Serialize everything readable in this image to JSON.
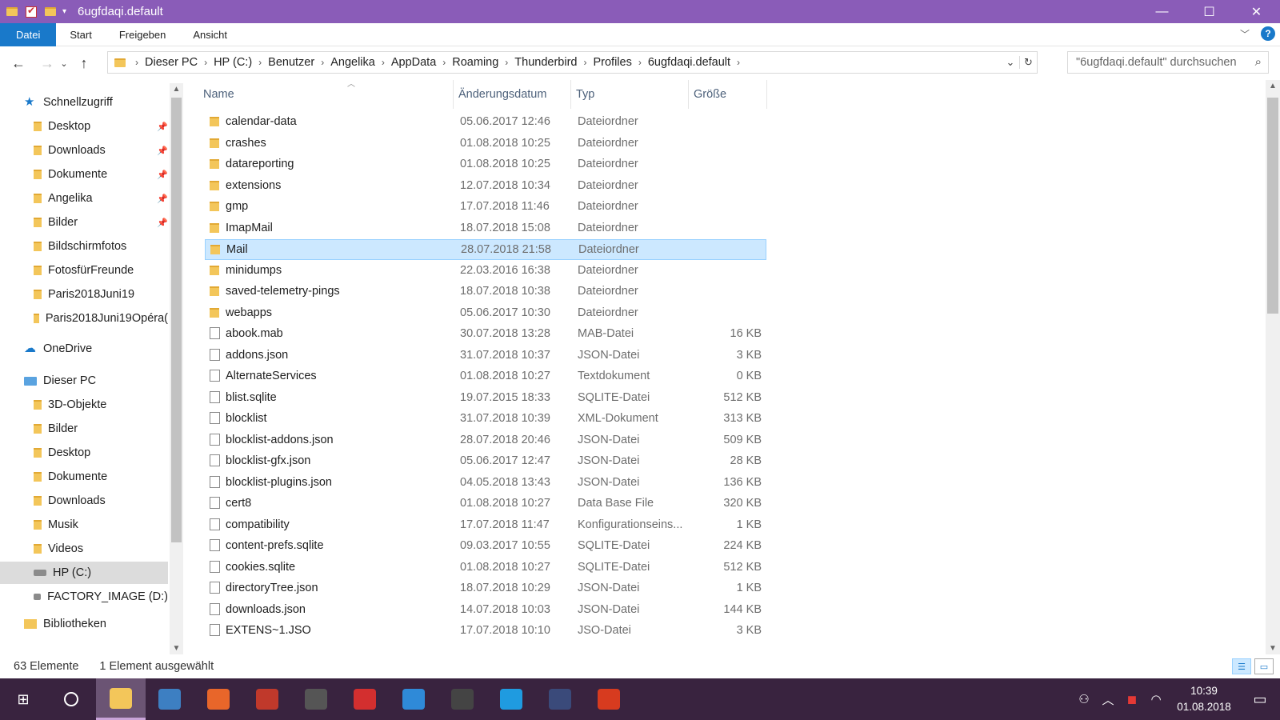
{
  "window": {
    "title": "6ugfdaqi.default",
    "controls": {
      "minimize": "—",
      "maximize": "☐",
      "close": "✕"
    }
  },
  "ribbon": {
    "tabs": [
      "Datei",
      "Start",
      "Freigeben",
      "Ansicht"
    ],
    "expand_icon": "chevron-down",
    "help": "?"
  },
  "address": {
    "crumbs": [
      "Dieser PC",
      "HP (C:)",
      "Benutzer",
      "Angelika",
      "AppData",
      "Roaming",
      "Thunderbird",
      "Profiles",
      "6ugfdaqi.default"
    ],
    "search_placeholder": "\"6ugfdaqi.default\" durchsuchen"
  },
  "nav": {
    "items": [
      {
        "label": "Schnellzugriff",
        "icon": "star",
        "pinned": false
      },
      {
        "label": "Desktop",
        "icon": "folder",
        "pinned": true
      },
      {
        "label": "Downloads",
        "icon": "folder",
        "pinned": true
      },
      {
        "label": "Dokumente",
        "icon": "folder",
        "pinned": true
      },
      {
        "label": "Angelika",
        "icon": "folder",
        "pinned": true
      },
      {
        "label": "Bilder",
        "icon": "folder",
        "pinned": true
      },
      {
        "label": "Bildschirmfotos",
        "icon": "folder",
        "pinned": false
      },
      {
        "label": "FotosfürFreunde",
        "icon": "folder",
        "pinned": false
      },
      {
        "label": "Paris2018Juni19",
        "icon": "folder",
        "pinned": false
      },
      {
        "label": "Paris2018Juni19Opéra(",
        "icon": "folder",
        "pinned": false
      },
      {
        "label": "OneDrive",
        "icon": "cloud",
        "pinned": false
      },
      {
        "label": "Dieser PC",
        "icon": "pc",
        "pinned": false
      },
      {
        "label": "3D-Objekte",
        "icon": "folder",
        "pinned": false
      },
      {
        "label": "Bilder",
        "icon": "folder",
        "pinned": false
      },
      {
        "label": "Desktop",
        "icon": "folder",
        "pinned": false
      },
      {
        "label": "Dokumente",
        "icon": "folder",
        "pinned": false
      },
      {
        "label": "Downloads",
        "icon": "folder",
        "pinned": false
      },
      {
        "label": "Musik",
        "icon": "folder",
        "pinned": false
      },
      {
        "label": "Videos",
        "icon": "folder",
        "pinned": false
      },
      {
        "label": "HP (C:)",
        "icon": "drive",
        "pinned": false,
        "selected": true
      },
      {
        "label": "FACTORY_IMAGE (D:)",
        "icon": "drive",
        "pinned": false
      },
      {
        "label": "Bibliotheken",
        "icon": "lib",
        "pinned": false
      }
    ]
  },
  "columns": {
    "name": "Name",
    "date": "Änderungsdatum",
    "type": "Typ",
    "size": "Größe"
  },
  "files": [
    {
      "name": "calendar-data",
      "date": "05.06.2017 12:46",
      "type": "Dateiordner",
      "size": "",
      "kind": "folder"
    },
    {
      "name": "crashes",
      "date": "01.08.2018 10:25",
      "type": "Dateiordner",
      "size": "",
      "kind": "folder"
    },
    {
      "name": "datareporting",
      "date": "01.08.2018 10:25",
      "type": "Dateiordner",
      "size": "",
      "kind": "folder"
    },
    {
      "name": "extensions",
      "date": "12.07.2018 10:34",
      "type": "Dateiordner",
      "size": "",
      "kind": "folder"
    },
    {
      "name": "gmp",
      "date": "17.07.2018 11:46",
      "type": "Dateiordner",
      "size": "",
      "kind": "folder"
    },
    {
      "name": "ImapMail",
      "date": "18.07.2018 15:08",
      "type": "Dateiordner",
      "size": "",
      "kind": "folder"
    },
    {
      "name": "Mail",
      "date": "28.07.2018 21:58",
      "type": "Dateiordner",
      "size": "",
      "kind": "folder",
      "selected": true
    },
    {
      "name": "minidumps",
      "date": "22.03.2016 16:38",
      "type": "Dateiordner",
      "size": "",
      "kind": "folder"
    },
    {
      "name": "saved-telemetry-pings",
      "date": "18.07.2018 10:38",
      "type": "Dateiordner",
      "size": "",
      "kind": "folder"
    },
    {
      "name": "webapps",
      "date": "05.06.2017 10:30",
      "type": "Dateiordner",
      "size": "",
      "kind": "folder"
    },
    {
      "name": "abook.mab",
      "date": "30.07.2018 13:28",
      "type": "MAB-Datei",
      "size": "16 KB",
      "kind": "file"
    },
    {
      "name": "addons.json",
      "date": "31.07.2018 10:37",
      "type": "JSON-Datei",
      "size": "3 KB",
      "kind": "file"
    },
    {
      "name": "AlternateServices",
      "date": "01.08.2018 10:27",
      "type": "Textdokument",
      "size": "0 KB",
      "kind": "file"
    },
    {
      "name": "blist.sqlite",
      "date": "19.07.2015 18:33",
      "type": "SQLITE-Datei",
      "size": "512 KB",
      "kind": "file"
    },
    {
      "name": "blocklist",
      "date": "31.07.2018 10:39",
      "type": "XML-Dokument",
      "size": "313 KB",
      "kind": "file"
    },
    {
      "name": "blocklist-addons.json",
      "date": "28.07.2018 20:46",
      "type": "JSON-Datei",
      "size": "509 KB",
      "kind": "file"
    },
    {
      "name": "blocklist-gfx.json",
      "date": "05.06.2017 12:47",
      "type": "JSON-Datei",
      "size": "28 KB",
      "kind": "file"
    },
    {
      "name": "blocklist-plugins.json",
      "date": "04.05.2018 13:43",
      "type": "JSON-Datei",
      "size": "136 KB",
      "kind": "file"
    },
    {
      "name": "cert8",
      "date": "01.08.2018 10:27",
      "type": "Data Base File",
      "size": "320 KB",
      "kind": "file"
    },
    {
      "name": "compatibility",
      "date": "17.07.2018 11:47",
      "type": "Konfigurationseins...",
      "size": "1 KB",
      "kind": "file"
    },
    {
      "name": "content-prefs.sqlite",
      "date": "09.03.2017 10:55",
      "type": "SQLITE-Datei",
      "size": "224 KB",
      "kind": "file"
    },
    {
      "name": "cookies.sqlite",
      "date": "01.08.2018 10:27",
      "type": "SQLITE-Datei",
      "size": "512 KB",
      "kind": "file"
    },
    {
      "name": "directoryTree.json",
      "date": "18.07.2018 10:29",
      "type": "JSON-Datei",
      "size": "1 KB",
      "kind": "file"
    },
    {
      "name": "downloads.json",
      "date": "14.07.2018 10:03",
      "type": "JSON-Datei",
      "size": "144 KB",
      "kind": "file"
    },
    {
      "name": "EXTENS~1.JSO",
      "date": "17.07.2018 10:10",
      "type": "JSO-Datei",
      "size": "3 KB",
      "kind": "file"
    }
  ],
  "status": {
    "count": "63 Elemente",
    "selection": "1 Element ausgewählt"
  },
  "taskbar": {
    "apps": [
      {
        "name": "explorer",
        "color": "#f3c65a",
        "active": true
      },
      {
        "name": "thunderbird",
        "color": "#3d7fc2"
      },
      {
        "name": "firefox",
        "color": "#e8662a"
      },
      {
        "name": "app-red",
        "color": "#c0392b"
      },
      {
        "name": "calculator",
        "color": "#555555"
      },
      {
        "name": "avira",
        "color": "#d32f2f"
      },
      {
        "name": "app-blue",
        "color": "#2f8ad8"
      },
      {
        "name": "mail",
        "color": "#444444"
      },
      {
        "name": "store",
        "color": "#1f9be0"
      },
      {
        "name": "media",
        "color": "#3a4a7a"
      },
      {
        "name": "app-redcircle",
        "color": "#d73b1f"
      }
    ],
    "time": "10:39",
    "date": "01.08.2018"
  }
}
